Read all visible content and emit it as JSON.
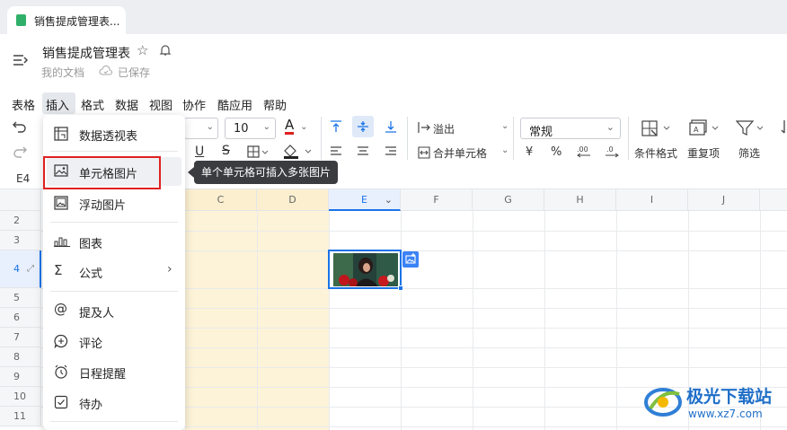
{
  "tab": {
    "title": "销售提成管理表..."
  },
  "doc": {
    "title": "销售提成管理表",
    "location": "我的文档",
    "status": "已保存"
  },
  "menubar": [
    "表格",
    "插入",
    "格式",
    "数据",
    "视图",
    "协作",
    "酷应用",
    "帮助"
  ],
  "toolbar": {
    "font_size": "10",
    "font_color_letter": "A",
    "overflow_label": "溢出",
    "merge_label": "合并单元格",
    "number_format": "常规",
    "currency_symbol": "¥",
    "percent_symbol": "%",
    "cond_format_label": "条件格式",
    "duplicate_label": "重复项",
    "filter_label": "筛选"
  },
  "namebox": "E4",
  "columns": [
    "C",
    "D",
    "E",
    "F",
    "G",
    "H",
    "I",
    "J"
  ],
  "rows": [
    "2",
    "3",
    "4",
    "5",
    "6",
    "7",
    "8",
    "9",
    "10",
    "11"
  ],
  "insert_menu": {
    "items": [
      "数据透视表",
      "单元格图片",
      "浮动图片",
      "图表",
      "公式",
      "提及人",
      "评论",
      "日程提醒",
      "待办"
    ]
  },
  "tooltip": "单个单元格可插入多张图片",
  "watermark": {
    "name": "极光下载站",
    "url": "www.xz7.com"
  },
  "colors": {
    "accent": "#1a73e8",
    "highlight_col": "#fdf3d8",
    "menu_highlight_border": "#e02020"
  }
}
